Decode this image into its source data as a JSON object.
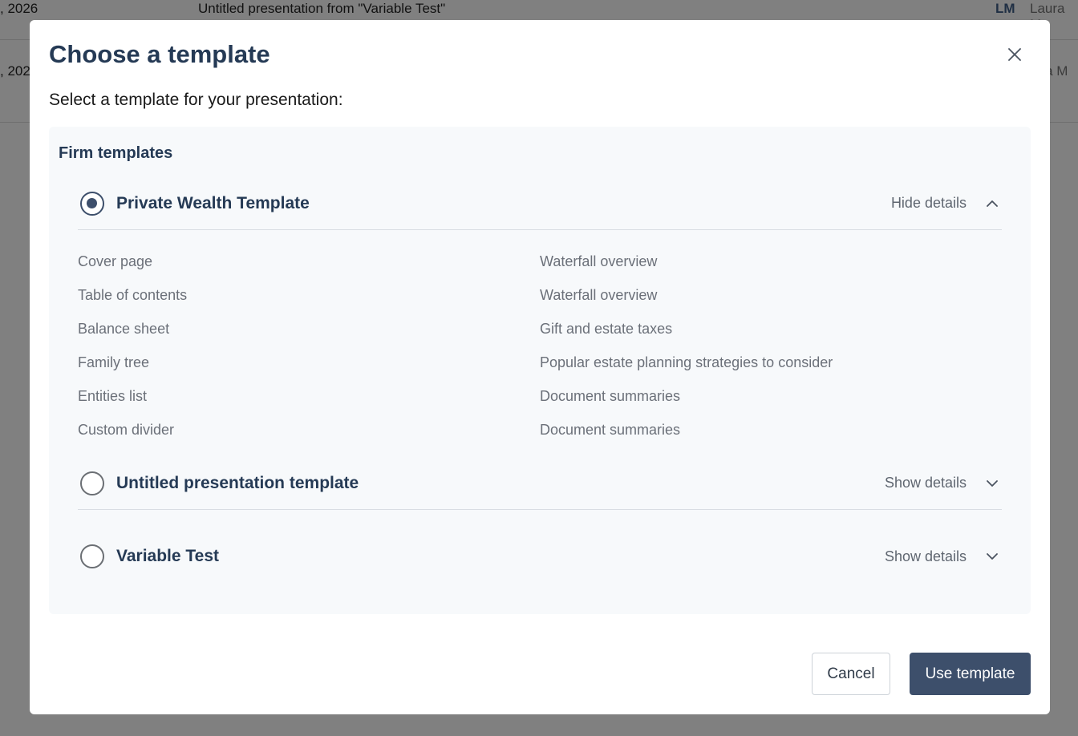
{
  "background": {
    "rows": [
      {
        "date": ", 2026",
        "title": "Untitled presentation from \"Variable Test\"",
        "initials": "LM",
        "owner": "Laura M"
      },
      {
        "date": ", 202",
        "owner": "ura M"
      }
    ]
  },
  "modal": {
    "title": "Choose a template",
    "subtitle": "Select a template for your presentation:",
    "close_icon": "close-icon",
    "group_title": "Firm templates",
    "templates": [
      {
        "name": "Private Wealth Template",
        "selected": true,
        "toggle_label": "Hide details",
        "toggle_icon": "chevron-up-icon",
        "details_left": [
          "Cover page",
          "Table of contents",
          "Balance sheet",
          "Family tree",
          "Entities list",
          "Custom divider"
        ],
        "details_right": [
          "Waterfall overview",
          "Waterfall overview",
          "Gift and estate taxes",
          "Popular estate planning strategies to consider",
          "Document summaries",
          "Document summaries"
        ]
      },
      {
        "name": "Untitled presentation template",
        "selected": false,
        "toggle_label": "Show details",
        "toggle_icon": "chevron-down-icon"
      },
      {
        "name": "Variable Test",
        "selected": false,
        "toggle_label": "Show details",
        "toggle_icon": "chevron-down-icon"
      }
    ],
    "cancel_label": "Cancel",
    "use_label": "Use template"
  },
  "colors": {
    "accent": "#3d4f6b",
    "title": "#253a55",
    "overlay": "#808080"
  }
}
